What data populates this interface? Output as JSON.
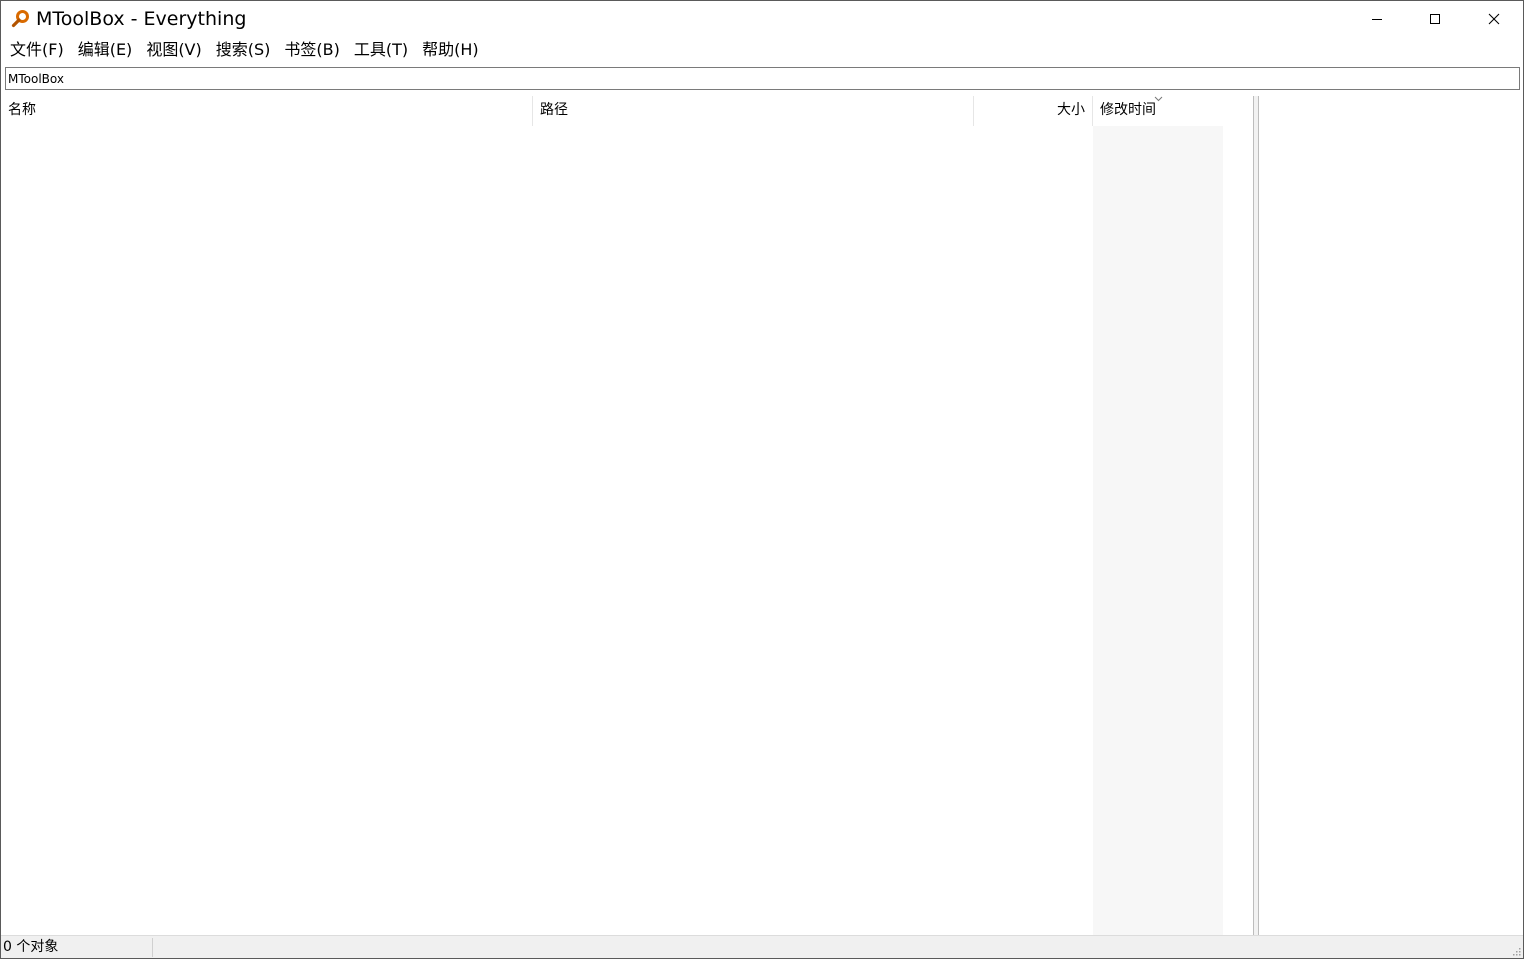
{
  "window": {
    "title": "MToolBox - Everything"
  },
  "icons": {
    "app": "search-magnifier-icon",
    "minimize": "minimize-icon",
    "maximize": "maximize-icon",
    "close": "close-icon",
    "sort": "sort-descending-icon",
    "grip": "resize-grip-icon"
  },
  "menu": {
    "items": [
      {
        "label": "文件(F)"
      },
      {
        "label": "编辑(E)"
      },
      {
        "label": "视图(V)"
      },
      {
        "label": "搜索(S)"
      },
      {
        "label": "书签(B)"
      },
      {
        "label": "工具(T)"
      },
      {
        "label": "帮助(H)"
      }
    ]
  },
  "search": {
    "value": "MToolBox"
  },
  "list": {
    "columns": {
      "name": "名称",
      "path": "路径",
      "size": "大小",
      "mtime": "修改时间"
    },
    "rows": []
  },
  "status": {
    "text": "0 个对象"
  },
  "colors": {
    "accent": "#d96a00",
    "sorted_column_bg": "#f7f7f7",
    "statusbar_bg": "#f0f0f0"
  }
}
